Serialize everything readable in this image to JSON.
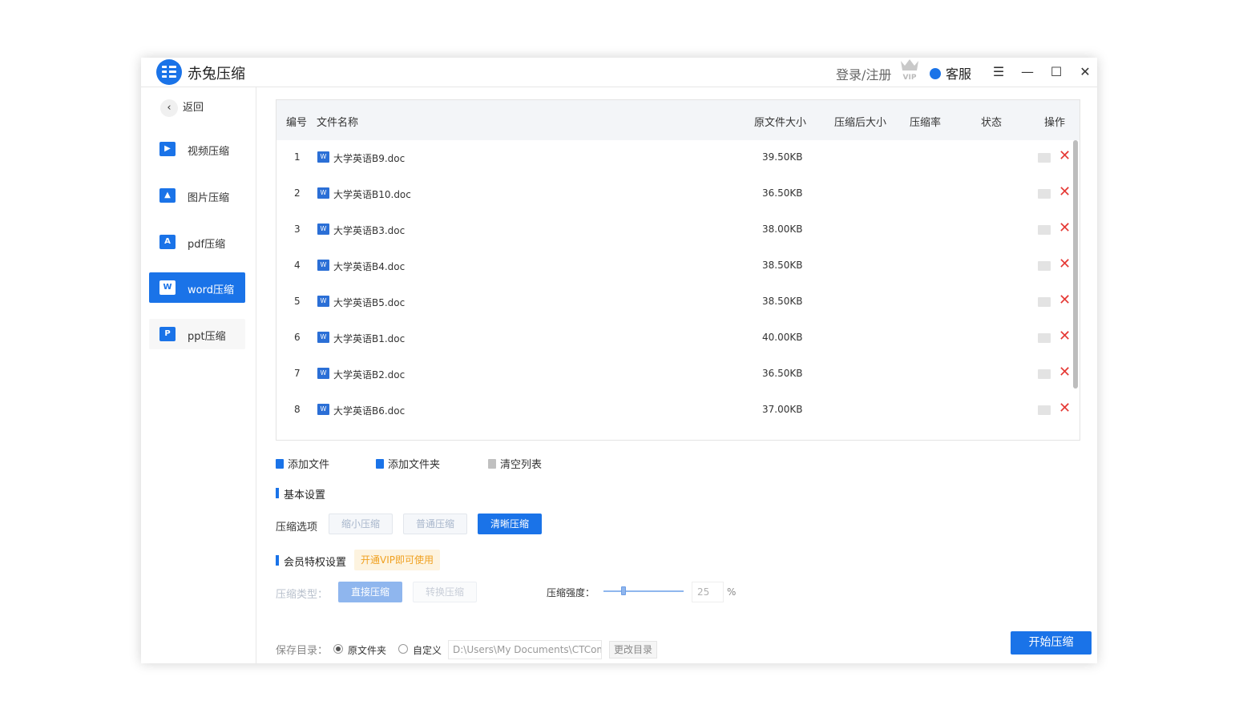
{
  "app": {
    "title": "赤兔压缩"
  },
  "header": {
    "login": "登录/注册",
    "vip": "VIP",
    "support": "客服"
  },
  "sidebar": {
    "back": "返回",
    "items": [
      {
        "label": "视频压缩",
        "icon": "video-icon"
      },
      {
        "label": "图片压缩",
        "icon": "image-icon"
      },
      {
        "label": "pdf压缩",
        "icon": "pdf-icon"
      },
      {
        "label": "word压缩",
        "icon": "word-icon"
      },
      {
        "label": "ppt压缩",
        "icon": "ppt-icon"
      }
    ],
    "active": "word压缩"
  },
  "table": {
    "headers": {
      "no": "编号",
      "name": "文件名称",
      "orig": "原文件大小",
      "after": "压缩后大小",
      "rate": "压缩率",
      "status": "状态",
      "action": "操作"
    },
    "rows": [
      {
        "no": "1",
        "name": "大学英语B9.doc",
        "size": "39.50KB"
      },
      {
        "no": "2",
        "name": "大学英语B10.doc",
        "size": "36.50KB"
      },
      {
        "no": "3",
        "name": "大学英语B3.doc",
        "size": "38.00KB"
      },
      {
        "no": "4",
        "name": "大学英语B4.doc",
        "size": "38.50KB"
      },
      {
        "no": "5",
        "name": "大学英语B5.doc",
        "size": "38.50KB"
      },
      {
        "no": "6",
        "name": "大学英语B1.doc",
        "size": "40.00KB"
      },
      {
        "no": "7",
        "name": "大学英语B2.doc",
        "size": "36.50KB"
      },
      {
        "no": "8",
        "name": "大学英语B6.doc",
        "size": "37.00KB"
      }
    ]
  },
  "toolbar": {
    "add_file": "添加文件",
    "add_folder": "添加文件夹",
    "clear": "清空列表"
  },
  "basic": {
    "title": "基本设置",
    "options_label": "压缩选项",
    "options": [
      "缩小压缩",
      "普通压缩",
      "清晰压缩"
    ],
    "selected": "清晰压缩"
  },
  "vip": {
    "title": "会员特权设置",
    "hint": "开通VIP即可使用",
    "type_label": "压缩类型：",
    "types": [
      "直接压缩",
      "转换压缩"
    ],
    "strength_label": "压缩强度：",
    "strength": "25",
    "unit": "%"
  },
  "save": {
    "label": "保存目录：",
    "option_original": "原文件夹",
    "option_custom": "自定义",
    "path": "D:\\Users\\My Documents\\CTCompr",
    "change": "更改目录",
    "selected": "原文件夹"
  },
  "start": "开始压缩",
  "colors": {
    "accent": "#1a73e8",
    "delete": "#e53935",
    "vip_hint": "#f0a020"
  }
}
